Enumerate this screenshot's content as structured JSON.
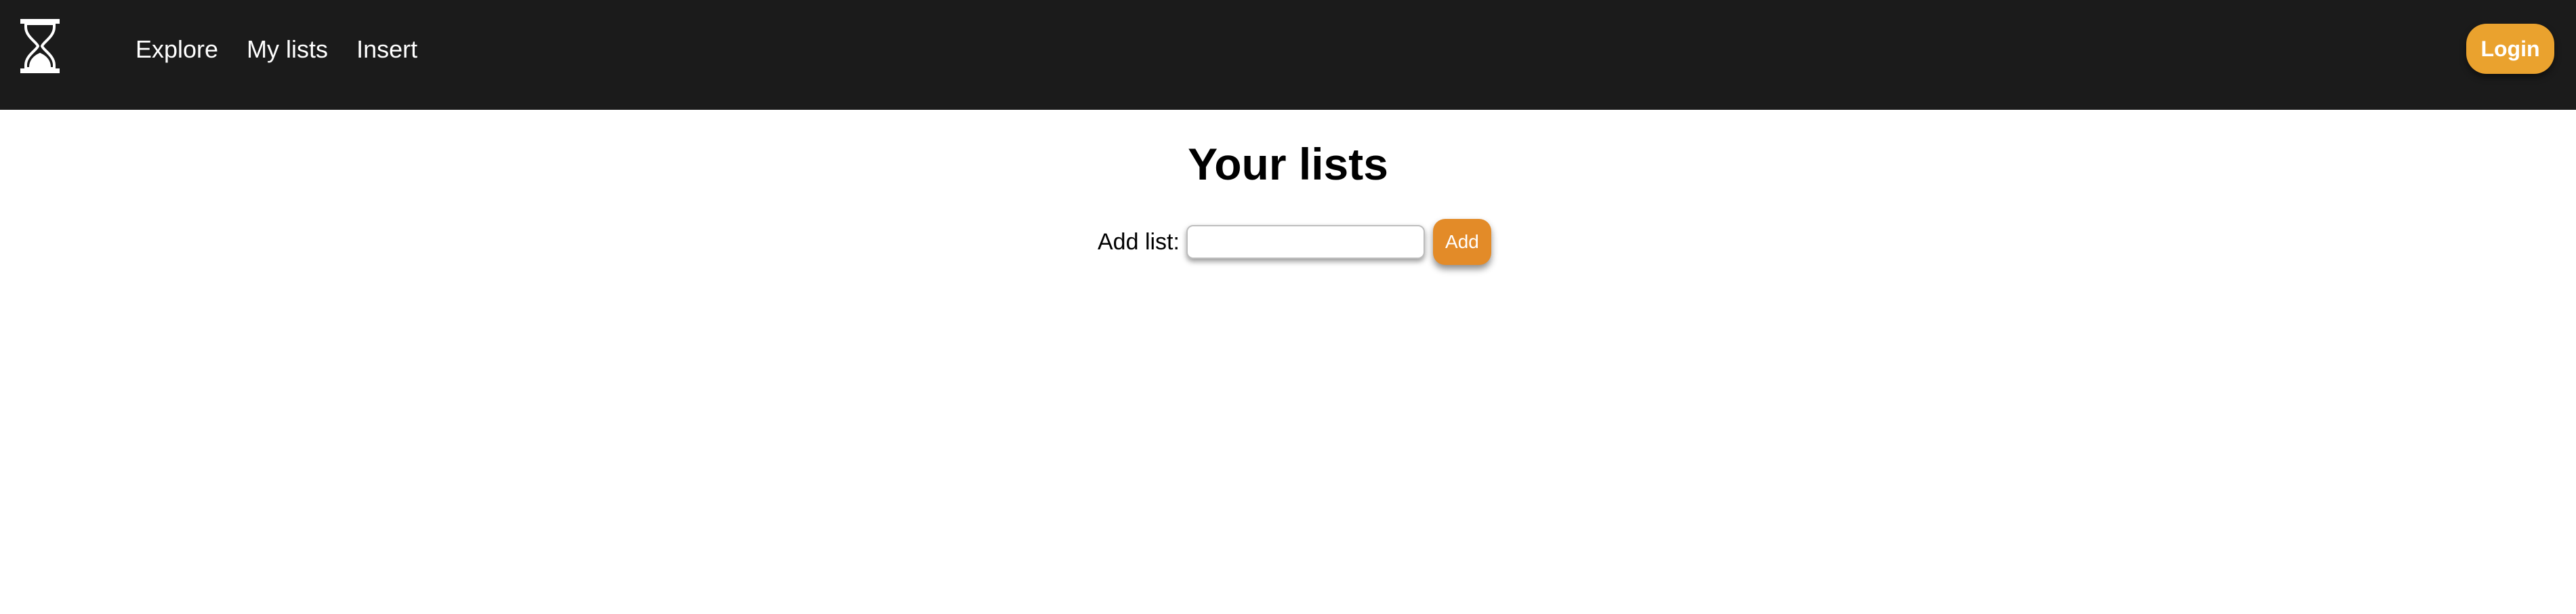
{
  "navbar": {
    "logo_icon": "hourglass-icon",
    "links": [
      {
        "label": "Explore"
      },
      {
        "label": "My lists"
      },
      {
        "label": "Insert"
      }
    ],
    "login_label": "Login",
    "background": "#1b1b1b",
    "accent": "#eaa22e"
  },
  "main": {
    "title": "Your lists",
    "add_list": {
      "label": "Add list:",
      "input_value": "",
      "input_placeholder": "",
      "button_label": "Add",
      "button_color": "#e38b28"
    }
  }
}
